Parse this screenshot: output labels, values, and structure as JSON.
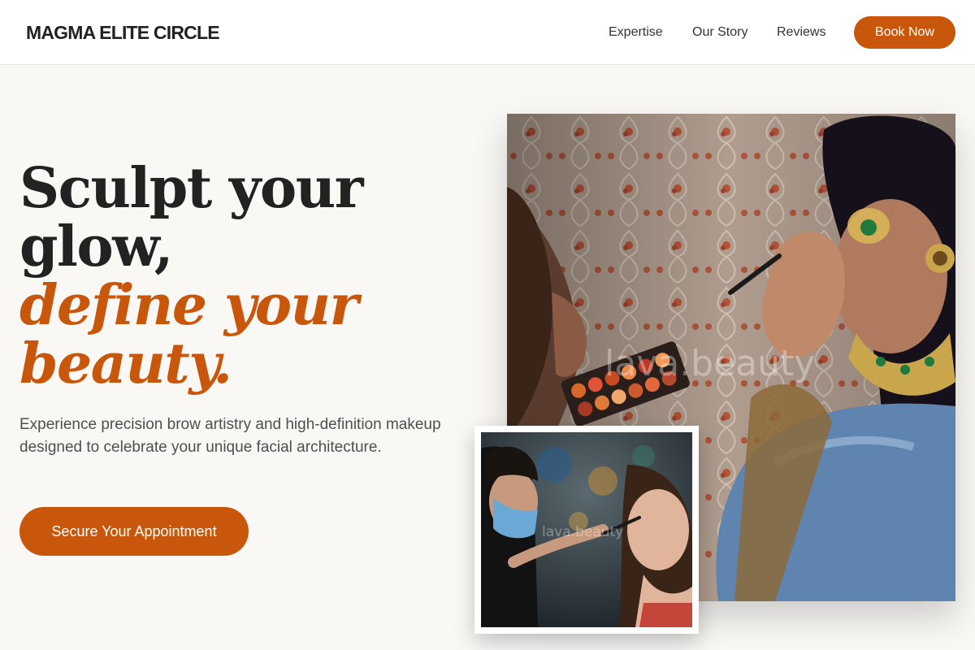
{
  "brand": {
    "name": "MAGMA ELITE CIRCLE"
  },
  "nav": {
    "links": [
      "Expertise",
      "Our Story",
      "Reviews"
    ],
    "cta": "Book Now"
  },
  "hero": {
    "headline_line1": "Sculpt your",
    "headline_line2": "glow,",
    "headline_accent_line1": "define your",
    "headline_accent_line2": "beauty.",
    "description": "Experience precision brow artistry and high-definition makeup designed to celebrate your unique facial architecture.",
    "cta": "Secure Your Appointment"
  },
  "images": {
    "main_watermark": "lava.beauty",
    "inset_watermark": "lava.beauty"
  },
  "colors": {
    "accent": "#c8570b",
    "background": "#faf8f5",
    "text_dark": "#222222",
    "text_body": "#4f4f4f"
  }
}
